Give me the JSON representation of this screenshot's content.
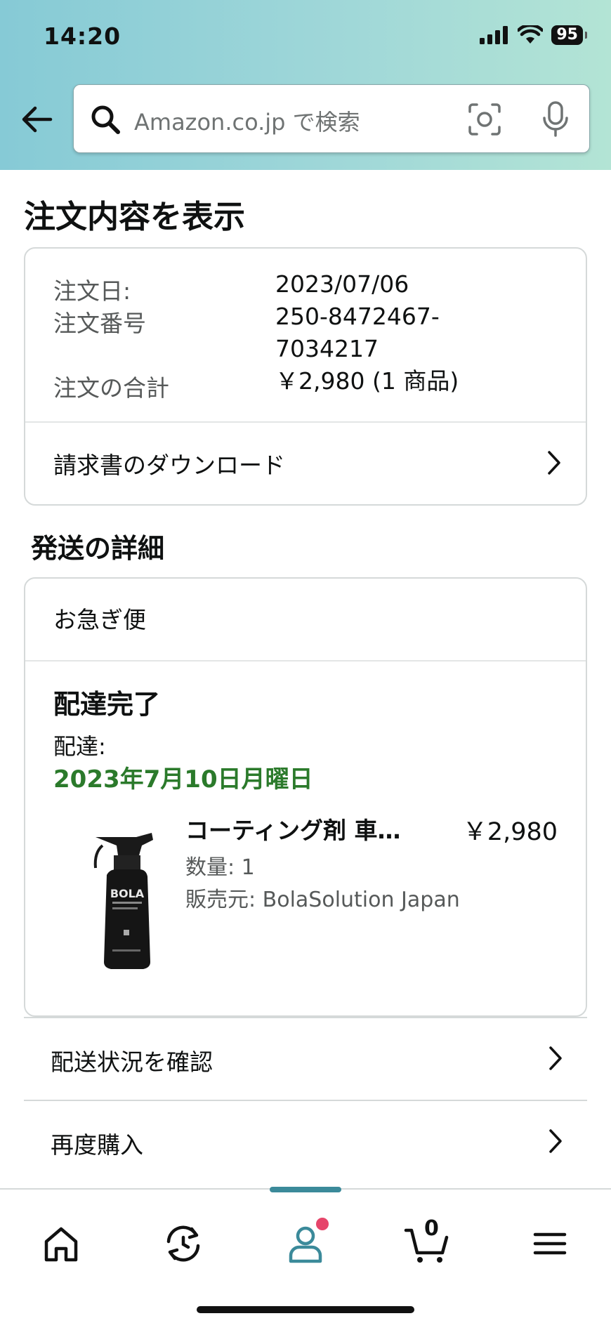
{
  "status_bar": {
    "time": "14:20",
    "battery": "95"
  },
  "search": {
    "placeholder": "Amazon.co.jp で検索"
  },
  "page_title": "注文内容を表示",
  "order": {
    "date_label": "注文日:",
    "date_value": "2023/07/06",
    "number_label": "注文番号",
    "number_value_line1": "250-8472467-",
    "number_value_line2": "7034217",
    "total_label": "注文の合計",
    "total_value": "￥2,980 (1 商品)",
    "invoice_link": "請求書のダウンロード"
  },
  "shipping": {
    "section_title": "発送の詳細",
    "method": "お急ぎ便",
    "status": "配達完了",
    "delivery_label": "配達:",
    "delivery_date": "2023年7月10日月曜日",
    "product": {
      "name": "コーティング剤 車…",
      "price": "￥2,980",
      "quantity": "数量: 1",
      "seller": "販売元: BolaSolution Japan",
      "bottle_text": "BOLA"
    }
  },
  "actions": [
    {
      "label": "配送状況を確認"
    },
    {
      "label": "再度購入"
    }
  ],
  "bottom_nav": {
    "cart_count": "0"
  },
  "colors": {
    "delivery_date": "#2b7a2b",
    "nav_active": "#3b8a9a",
    "badge": "#e6456a"
  }
}
